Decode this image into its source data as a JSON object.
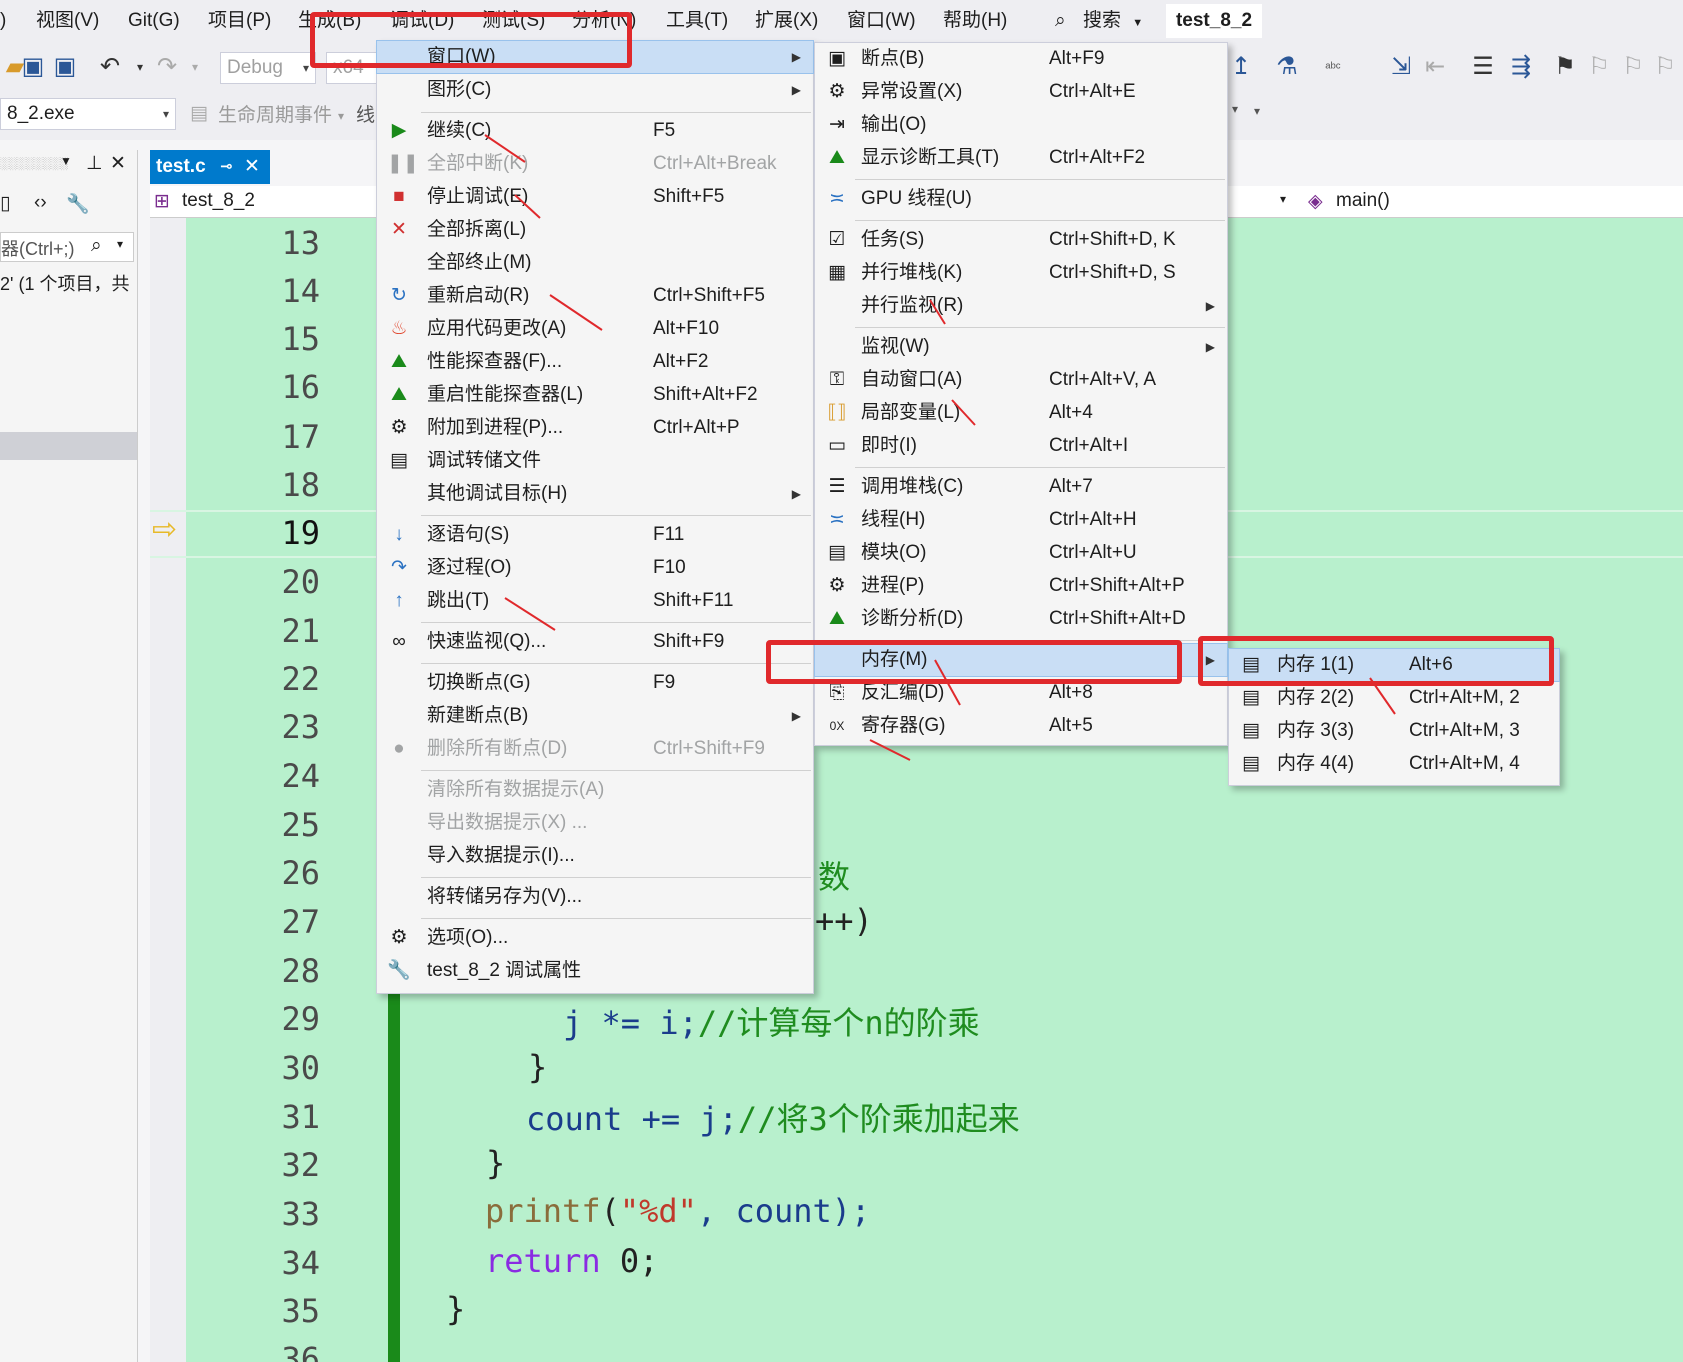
{
  "menubar": {
    "items": [
      "视图(V)",
      "Git(G)",
      "项目(P)",
      "生成(B)",
      "调试(D)",
      "测试(S)",
      "分析(N)",
      "工具(T)",
      "扩展(X)",
      "窗口(W)",
      "帮助(H)"
    ],
    "search": "搜索",
    "solution": "test_8_2"
  },
  "toolbar": {
    "config": "Debug",
    "platform": "x64",
    "startup": "8_2.exe",
    "lifecycle": "生命周期事件",
    "thread_prefix": "线"
  },
  "left_pane": {
    "search_placeholder": "器(Ctrl+;)",
    "summary": "2' (1 个项目，共"
  },
  "editor": {
    "tab": "test.c",
    "scope_left": "test_8_2",
    "scope_right": "main()",
    "line_numbers": [
      "13",
      "14",
      "15",
      "16",
      "17",
      "18",
      "19",
      "20",
      "21",
      "22",
      "23",
      "24",
      "25",
      "26",
      "27",
      "28",
      "29",
      "30",
      "31",
      "32",
      "33",
      "34",
      "35",
      "36"
    ],
    "code_fragments": {
      "l26": "数",
      "l27": "++)",
      "l29_code": "j *= i;",
      "l29_comment": "//计算每个n的阶乘",
      "l30": "}",
      "l31_code": "count += j;",
      "l31_comment": "//将3个阶乘加起来",
      "l32": "}",
      "l33_fn": "printf",
      "l33_str": "\"%d\"",
      "l33_rest": ", count);",
      "l34_kw": "return",
      "l34_rest": " 0;",
      "l35": "}"
    }
  },
  "debug_menu": {
    "items": [
      {
        "label": "窗口(W)",
        "shortcut": "",
        "icon": "window-icon"
      },
      {
        "label": "图形(C)",
        "shortcut": "",
        "icon": ""
      },
      {
        "label": "继续(C)",
        "shortcut": "F5",
        "icon": "play-icon"
      },
      {
        "label": "全部中断(K)",
        "shortcut": "Ctrl+Alt+Break",
        "icon": "pause-icon"
      },
      {
        "label": "停止调试(E)",
        "shortcut": "Shift+F5",
        "icon": "stop-icon"
      },
      {
        "label": "全部拆离(L)",
        "shortcut": "",
        "icon": "detach-icon"
      },
      {
        "label": "全部终止(M)",
        "shortcut": "",
        "icon": ""
      },
      {
        "label": "重新启动(R)",
        "shortcut": "Ctrl+Shift+F5",
        "icon": "restart-icon"
      },
      {
        "label": "应用代码更改(A)",
        "shortcut": "Alt+F10",
        "icon": "hot-reload-icon"
      },
      {
        "label": "性能探查器(F)...",
        "shortcut": "Alt+F2",
        "icon": "profiler-icon"
      },
      {
        "label": "重启性能探查器(L)",
        "shortcut": "Shift+Alt+F2",
        "icon": "profiler-restart-icon"
      },
      {
        "label": "附加到进程(P)...",
        "shortcut": "Ctrl+Alt+P",
        "icon": "attach-icon"
      },
      {
        "label": "调试转储文件",
        "shortcut": "",
        "icon": "dump-icon"
      },
      {
        "label": "其他调试目标(H)",
        "shortcut": "",
        "icon": ""
      },
      {
        "label": "逐语句(S)",
        "shortcut": "F11",
        "icon": "step-into-icon"
      },
      {
        "label": "逐过程(O)",
        "shortcut": "F10",
        "icon": "step-over-icon"
      },
      {
        "label": "跳出(T)",
        "shortcut": "Shift+F11",
        "icon": "step-out-icon"
      },
      {
        "label": "快速监视(Q)...",
        "shortcut": "Shift+F9",
        "icon": "quickwatch-icon"
      },
      {
        "label": "切换断点(G)",
        "shortcut": "F9",
        "icon": ""
      },
      {
        "label": "新建断点(B)",
        "shortcut": "",
        "icon": ""
      },
      {
        "label": "删除所有断点(D)",
        "shortcut": "Ctrl+Shift+F9",
        "icon": "delete-breakpoints-icon"
      },
      {
        "label": "清除所有数据提示(A)",
        "shortcut": "",
        "icon": ""
      },
      {
        "label": "导出数据提示(X) ...",
        "shortcut": "",
        "icon": ""
      },
      {
        "label": "导入数据提示(I)...",
        "shortcut": "",
        "icon": ""
      },
      {
        "label": "将转储另存为(V)...",
        "shortcut": "",
        "icon": ""
      },
      {
        "label": "选项(O)...",
        "shortcut": "",
        "icon": "gear-icon"
      },
      {
        "label": "test_8_2 调试属性",
        "shortcut": "",
        "icon": "wrench-icon"
      }
    ]
  },
  "window_menu": {
    "items": [
      {
        "label": "断点(B)",
        "shortcut": "Alt+F9"
      },
      {
        "label": "异常设置(X)",
        "shortcut": "Ctrl+Alt+E"
      },
      {
        "label": "输出(O)",
        "shortcut": ""
      },
      {
        "label": "显示诊断工具(T)",
        "shortcut": "Ctrl+Alt+F2"
      },
      {
        "label": "GPU 线程(U)",
        "shortcut": ""
      },
      {
        "label": "任务(S)",
        "shortcut": "Ctrl+Shift+D, K"
      },
      {
        "label": "并行堆栈(K)",
        "shortcut": "Ctrl+Shift+D, S"
      },
      {
        "label": "并行监视(R)",
        "shortcut": ""
      },
      {
        "label": "监视(W)",
        "shortcut": ""
      },
      {
        "label": "自动窗口(A)",
        "shortcut": "Ctrl+Alt+V, A"
      },
      {
        "label": "局部变量(L)",
        "shortcut": "Alt+4"
      },
      {
        "label": "即时(I)",
        "shortcut": "Ctrl+Alt+I"
      },
      {
        "label": "调用堆栈(C)",
        "shortcut": "Alt+7"
      },
      {
        "label": "线程(H)",
        "shortcut": "Ctrl+Alt+H"
      },
      {
        "label": "模块(O)",
        "shortcut": "Ctrl+Alt+U"
      },
      {
        "label": "进程(P)",
        "shortcut": "Ctrl+Shift+Alt+P"
      },
      {
        "label": "诊断分析(D)",
        "shortcut": "Ctrl+Shift+Alt+D"
      },
      {
        "label": "内存(M)",
        "shortcut": ""
      },
      {
        "label": "反汇编(D)",
        "shortcut": "Alt+8"
      },
      {
        "label": "寄存器(G)",
        "shortcut": "Alt+5"
      }
    ]
  },
  "memory_menu": {
    "items": [
      {
        "label": "内存 1(1)",
        "shortcut": "Alt+6"
      },
      {
        "label": "内存 2(2)",
        "shortcut": "Ctrl+Alt+M, 2"
      },
      {
        "label": "内存 3(3)",
        "shortcut": "Ctrl+Alt+M, 3"
      },
      {
        "label": "内存 4(4)",
        "shortcut": "Ctrl+Alt+M, 4"
      }
    ]
  },
  "colors": {
    "editor_bg": "#b8f0cd",
    "accent": "#007acc",
    "highlight": "#c9def5",
    "annotation_red": "#e0292c",
    "comment": "#1f8c1f",
    "keyword": "#8a2be2",
    "function": "#8a6d3b",
    "string": "#c0392b"
  }
}
